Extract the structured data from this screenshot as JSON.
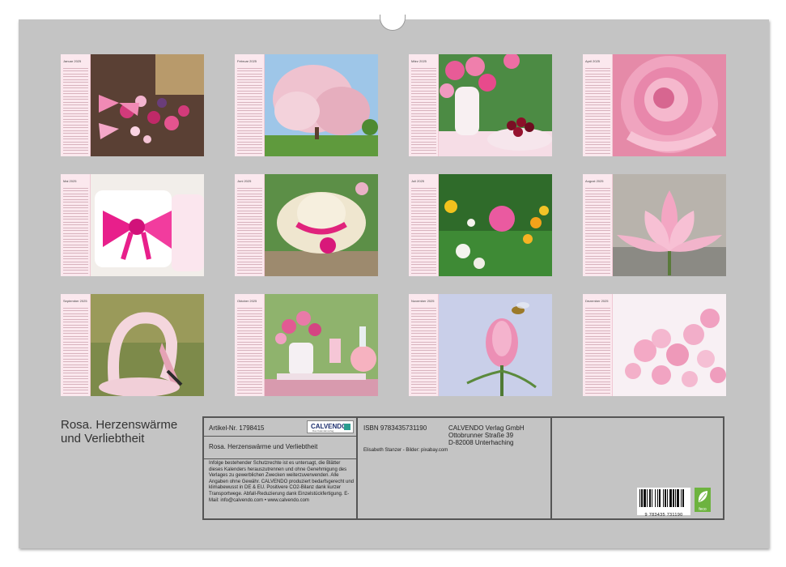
{
  "months": [
    {
      "label": "Januar 2025"
    },
    {
      "label": "Februar 2025"
    },
    {
      "label": "März 2025"
    },
    {
      "label": "April 2025"
    },
    {
      "label": "Mai 2025"
    },
    {
      "label": "Juni 2025"
    },
    {
      "label": "Juli 2025"
    },
    {
      "label": "August 2025"
    },
    {
      "label": "September 2025"
    },
    {
      "label": "Oktober 2025"
    },
    {
      "label": "November 2025"
    },
    {
      "label": "Dezember 2025"
    }
  ],
  "cover": {
    "title": "Rosa. Herzenswärme und Verliebtheit"
  },
  "info": {
    "article": "Artikel-Nr. 1798415",
    "logo": "CALVENDO",
    "logo_sub": "Das Kalenderverlag",
    "subtitle": "Rosa. Herzenswärme und Verliebtheit",
    "legal": "Infolge bestehender Schutzrechte ist es untersagt, die Blätter dieses Kalenders herauszutrennen und ohne Genehmigung des Verlages zu gewerblichen Zwecken weiterzuverwenden. Alle Angaben ohne Gewähr. CALVENDO produziert bedarfsgerecht und klimabewusst in DE & EU. Positivere CO2-Bilanz dank kurzer Transportwege. Abfall-Reduzierung dank Einzelstückfertigung. E-Mail: info@calvendo.com • www.calvendo.com",
    "isbn": "ISBN 9783435731190",
    "publisher_lines": [
      "CALVENDO Verlag GmbH",
      "Ottobrunner Straße 39",
      "D-82008 Unterhaching"
    ],
    "credits": "Elisabeth Stanzer - Bilder: pixabay.com",
    "barcode_digits": "9 783435 731190",
    "eco_label": "feco"
  },
  "colors": {
    "background": "#c4c4c4",
    "calendar_strip": "#fbe8ee",
    "accent_pink": "#e8408a"
  }
}
